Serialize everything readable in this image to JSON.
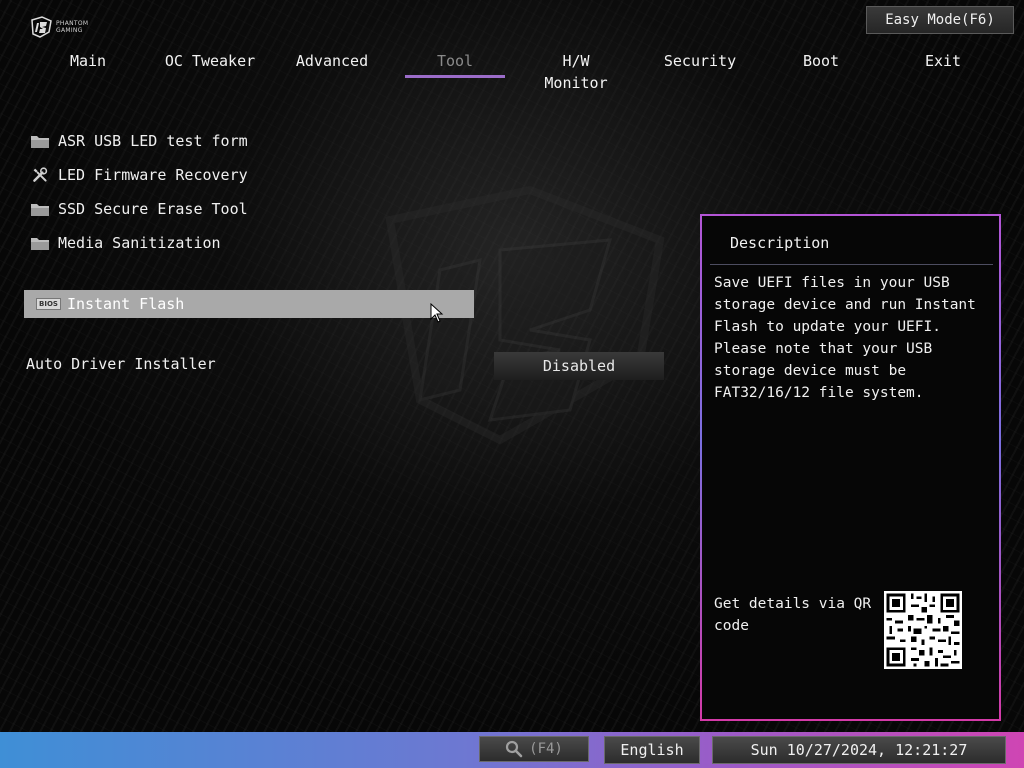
{
  "brand": {
    "logo_text_line1": "PHANTOM",
    "logo_text_line2": "GAMING"
  },
  "header": {
    "easy_mode_label": "Easy Mode(F6)"
  },
  "tabs": [
    {
      "label": "Main"
    },
    {
      "label": "OC Tweaker"
    },
    {
      "label": "Advanced"
    },
    {
      "label": "Tool",
      "active": true
    },
    {
      "label": "H/W Monitor"
    },
    {
      "label": "Security"
    },
    {
      "label": "Boot"
    },
    {
      "label": "Exit"
    }
  ],
  "menu": {
    "items": [
      {
        "label": "ASR USB LED test form",
        "icon": "folder-icon"
      },
      {
        "label": "LED Firmware Recovery",
        "icon": "tools-icon"
      },
      {
        "label": "SSD Secure Erase Tool",
        "icon": "folder-icon"
      },
      {
        "label": "Media Sanitization",
        "icon": "folder-icon"
      }
    ],
    "selected": {
      "label": "Instant Flash",
      "icon_text": "BIOS"
    }
  },
  "settings": {
    "auto_driver_installer": {
      "label": "Auto Driver Installer",
      "value": "Disabled"
    }
  },
  "description": {
    "title": "Description",
    "body": "Save UEFI files in your USB storage device and run Instant Flash to update your UEFI. Please note that your USB storage device must be FAT32/16/12 file system.",
    "qr_caption": "Get details via QR code"
  },
  "footer": {
    "search_shortcut": "(F4)",
    "language": "English",
    "datetime": "Sun 10/27/2024, 12:21:27"
  },
  "colors": {
    "tab_active_underline": "#9b6cc9",
    "selected_row_bg": "#a9a9a9",
    "panel_border_top": "#b455d6",
    "panel_border_bottom": "#d43aa8",
    "footer_left": "#3f8fd6",
    "footer_right": "#cf45b3"
  }
}
